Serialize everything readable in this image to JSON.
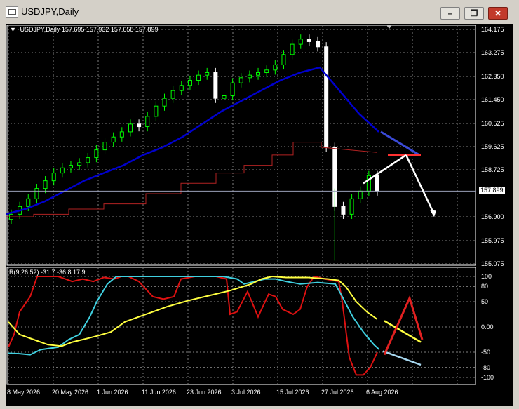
{
  "window": {
    "title": "USDJPY,Daily",
    "minimize_glyph": "–",
    "restore_glyph": "❐",
    "close_glyph": "✕"
  },
  "chart_header": {
    "symbol_period": "USDJPY,Daily",
    "ohlc": "157.695 157.932 157.658 157.899"
  },
  "price_axis": {
    "ticks": [
      "164.175",
      "163.275",
      "162.350",
      "161.450",
      "160.525",
      "159.625",
      "158.725",
      "156.900",
      "155.975",
      "155.075"
    ],
    "current_price": "157.899"
  },
  "indicator": {
    "header": "R(9,26,52) -31.7 -36.8 17.9",
    "ticks": [
      "100",
      "80",
      "50",
      "0.00",
      "-50",
      "-80",
      "-100"
    ]
  },
  "time_axis": {
    "labels": [
      "8 May 2026",
      "20 May 2026",
      "1 Jun 2026",
      "11 Jun 2026",
      "23 Jun 2026",
      "3 Jul 2026",
      "15 Jul 2026",
      "27 Jul 2026",
      "6 Aug 2026"
    ]
  },
  "colors": {
    "background": "#000000",
    "grid": "#7f7f7f",
    "bull_candle": "#00ff00",
    "bear_candle": "#ffffff",
    "moving_average": "#0000cd",
    "baseline_line": "#b22222",
    "forecast_red": "#ff3030",
    "indicator_red": "#dd1111",
    "indicator_cyan": "#40d0e0",
    "indicator_yellow": "#ffff40"
  },
  "chart_data": {
    "type": "candlestick",
    "symbol": "USDJPY",
    "timeframe": "Daily",
    "x": [
      "8 May 2026",
      "20 May 2026",
      "1 Jun 2026",
      "11 Jun 2026",
      "23 Jun 2026",
      "3 Jul 2026",
      "15 Jul 2026",
      "27 Jul 2026",
      "6 Aug 2026"
    ],
    "candles_close": [
      157.0,
      157.3,
      157.6,
      158.0,
      158.3,
      158.6,
      158.8,
      158.9,
      159.0,
      159.2,
      159.5,
      159.8,
      160.0,
      160.2,
      160.5,
      160.4,
      160.8,
      161.2,
      161.5,
      161.8,
      162.0,
      162.2,
      162.4,
      162.5,
      161.5,
      161.6,
      162.1,
      162.3,
      162.4,
      162.5,
      162.6,
      162.8,
      163.2,
      163.6,
      163.8,
      163.7,
      163.5,
      159.6,
      157.3,
      157.0,
      157.6,
      157.9,
      158.5,
      157.9
    ],
    "ma_blue": [
      157.0,
      157.2,
      157.5,
      157.9,
      158.3,
      158.6,
      158.9,
      159.3,
      159.6,
      160.0,
      160.5,
      161.0,
      161.4,
      161.8,
      162.2,
      162.5,
      162.7,
      161.8,
      160.9,
      160.2
    ],
    "forecast": {
      "blue_target": 159.3,
      "red_level": 159.3,
      "white_arrow_to": 157.0
    },
    "indicator_series": [
      {
        "name": "R(9,26,52)",
        "last": -31.7
      },
      {
        "name": "",
        "last": -36.8
      },
      {
        "name": "",
        "last": 17.9
      }
    ],
    "ylim": [
      155.075,
      164.175
    ],
    "indicator_ylim": [
      -100,
      100
    ]
  }
}
